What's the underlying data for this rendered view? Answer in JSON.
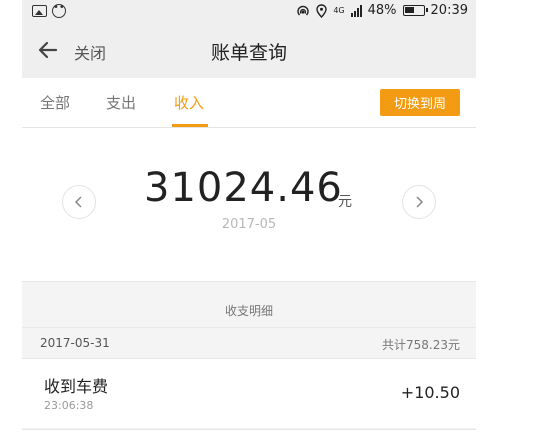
{
  "status_bar": {
    "battery": "48%",
    "time": "20:39",
    "network": "4G"
  },
  "header": {
    "back_label": "关闭",
    "title": "账单查询"
  },
  "tabs": [
    {
      "label": "全部",
      "active": false
    },
    {
      "label": "支出",
      "active": false
    },
    {
      "label": "收入",
      "active": true
    }
  ],
  "switch_button_label": "切换到周",
  "summary": {
    "amount": "31024.46",
    "currency": "元",
    "month": "2017-05"
  },
  "detail": {
    "header_label": "收支明细",
    "groups": [
      {
        "date": "2017-05-31",
        "total": "共计758.23元",
        "records": [
          {
            "title": "收到车费",
            "time": "23:06:38",
            "amount": "+10.50"
          }
        ]
      }
    ]
  },
  "colors": {
    "accent": "#f29b13",
    "header_bg": "#efefef",
    "section_bg": "#f4f4f4"
  },
  "icons": {
    "back": "arrow-left-icon",
    "prev": "chevron-left-icon",
    "next": "chevron-right-icon"
  }
}
